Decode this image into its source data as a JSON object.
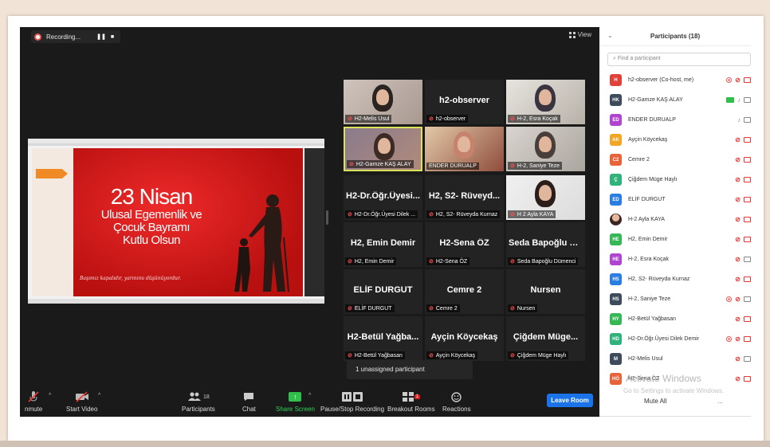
{
  "recording": {
    "label": "Recording..."
  },
  "view": {
    "label": "View"
  },
  "slide": {
    "title_line1": "23 Nisan",
    "title_line2": "Ulusal Egemenlik ve",
    "title_line3": "Çocuk Bayramı",
    "title_line4": "Kutlu Olsun",
    "quote": "Başımız kapalıdır, yarınımı düşünüyordur."
  },
  "gallery": [
    {
      "name": "H2-Melis Usul",
      "big": "",
      "video": true
    },
    {
      "name": "h2-observer",
      "big": "h2-observer",
      "video": false
    },
    {
      "name": "H-2, Esra Koçak",
      "big": "",
      "video": true
    },
    {
      "name": "H2-Gamze KAŞ ALAY",
      "big": "",
      "video": true,
      "active": true
    },
    {
      "name": "ENDER DURUALP",
      "big": "",
      "video": true
    },
    {
      "name": "H-2, Saniye Teze",
      "big": "",
      "video": true
    },
    {
      "name": "H2-Dr.Öğr.Üyesi Dilek ...",
      "big": "H2-Dr.Öğr.Üyesi...",
      "video": false
    },
    {
      "name": "H2, S2- Rüveyda Kurnaz",
      "big": "H2, S2- Rüveyd...",
      "video": false
    },
    {
      "name": "H 2 Ayla KAYA",
      "big": "",
      "video": true
    },
    {
      "name": "H2, Emin Demir",
      "big": "H2, Emin Demir",
      "video": false
    },
    {
      "name": "H2-Sena ÖZ",
      "big": "H2-Sena ÖZ",
      "video": false
    },
    {
      "name": "Seda Bapoğlu Dümenci",
      "big": "Seda Bapoğlu D...",
      "video": false
    },
    {
      "name": "ELİF DURGUT",
      "big": "ELİF DURGUT",
      "video": false
    },
    {
      "name": "Cemre 2",
      "big": "Cemre 2",
      "video": false
    },
    {
      "name": "Nursen",
      "big": "Nursen",
      "video": false
    },
    {
      "name": "H2-Betül Yağbasan",
      "big": "H2-Betül Yağba...",
      "video": false
    },
    {
      "name": "Ayçin Köycekaş",
      "big": "Ayçin Köycekaş",
      "video": false
    },
    {
      "name": "Çiğdem Müge Haylı",
      "big": "Çiğdem Müge...",
      "video": false
    }
  ],
  "unassigned": "1 unassigned participant",
  "toolbar": {
    "unmute": "nmute",
    "start_video": "Start Video",
    "participants": "Participants",
    "participants_count": "18",
    "chat": "Chat",
    "share_screen": "Share Screen",
    "pause_recording": "Pause/Stop Recording",
    "breakout": "Breakout Rooms",
    "breakout_badge": "1",
    "reactions": "Reactions",
    "leave": "Leave Room"
  },
  "panel": {
    "title": "Participants (18)",
    "search_placeholder": "Find a participant",
    "participants": [
      {
        "initials": "H",
        "name": "h2-observer (Co-host, me)",
        "color": "#e0423a"
      },
      {
        "initials": "HK",
        "name": "H2-Gamze KAŞ ALAY",
        "color": "#3d4b5c"
      },
      {
        "initials": "ED",
        "name": "ENDER DURUALP",
        "color": "#b145d1"
      },
      {
        "initials": "AK",
        "name": "Ayçin Köycekaş",
        "color": "#f2a623"
      },
      {
        "initials": "C2",
        "name": "Cemre 2",
        "color": "#e8633a"
      },
      {
        "initials": "Ç",
        "name": "Çiğdem Müge Haylı",
        "color": "#2fb37a"
      },
      {
        "initials": "ED",
        "name": "ELİF DURGUT",
        "color": "#2a7de1"
      },
      {
        "initials": "",
        "name": "H-2 Ayla KAYA",
        "color": "#c98b6b"
      },
      {
        "initials": "HE",
        "name": "H2, Emin Demir",
        "color": "#34b856"
      },
      {
        "initials": "HE",
        "name": "H-2, Esra Koçak",
        "color": "#b145d1"
      },
      {
        "initials": "HS",
        "name": "H2, S2- Rüveyda Kurnaz",
        "color": "#2a7de1"
      },
      {
        "initials": "HS",
        "name": "H-2, Saniye Teze",
        "color": "#3d4b5c"
      },
      {
        "initials": "HY",
        "name": "H2-Betül Yağbasan",
        "color": "#34b856"
      },
      {
        "initials": "HD",
        "name": "H2-Dr.Öğr.Üyesi Dilek Demir",
        "color": "#2fb37a"
      },
      {
        "initials": "M",
        "name": "H2-Melis Usul",
        "color": "#3d4b5c"
      },
      {
        "initials": "HÖ",
        "name": "H2-Sena ÖZ",
        "color": "#e8633a"
      }
    ],
    "watermark_title": "Activate Windows",
    "watermark_sub": "Go to Settings to activate Windows.",
    "mute_all": "Mute All",
    "more": "..."
  }
}
